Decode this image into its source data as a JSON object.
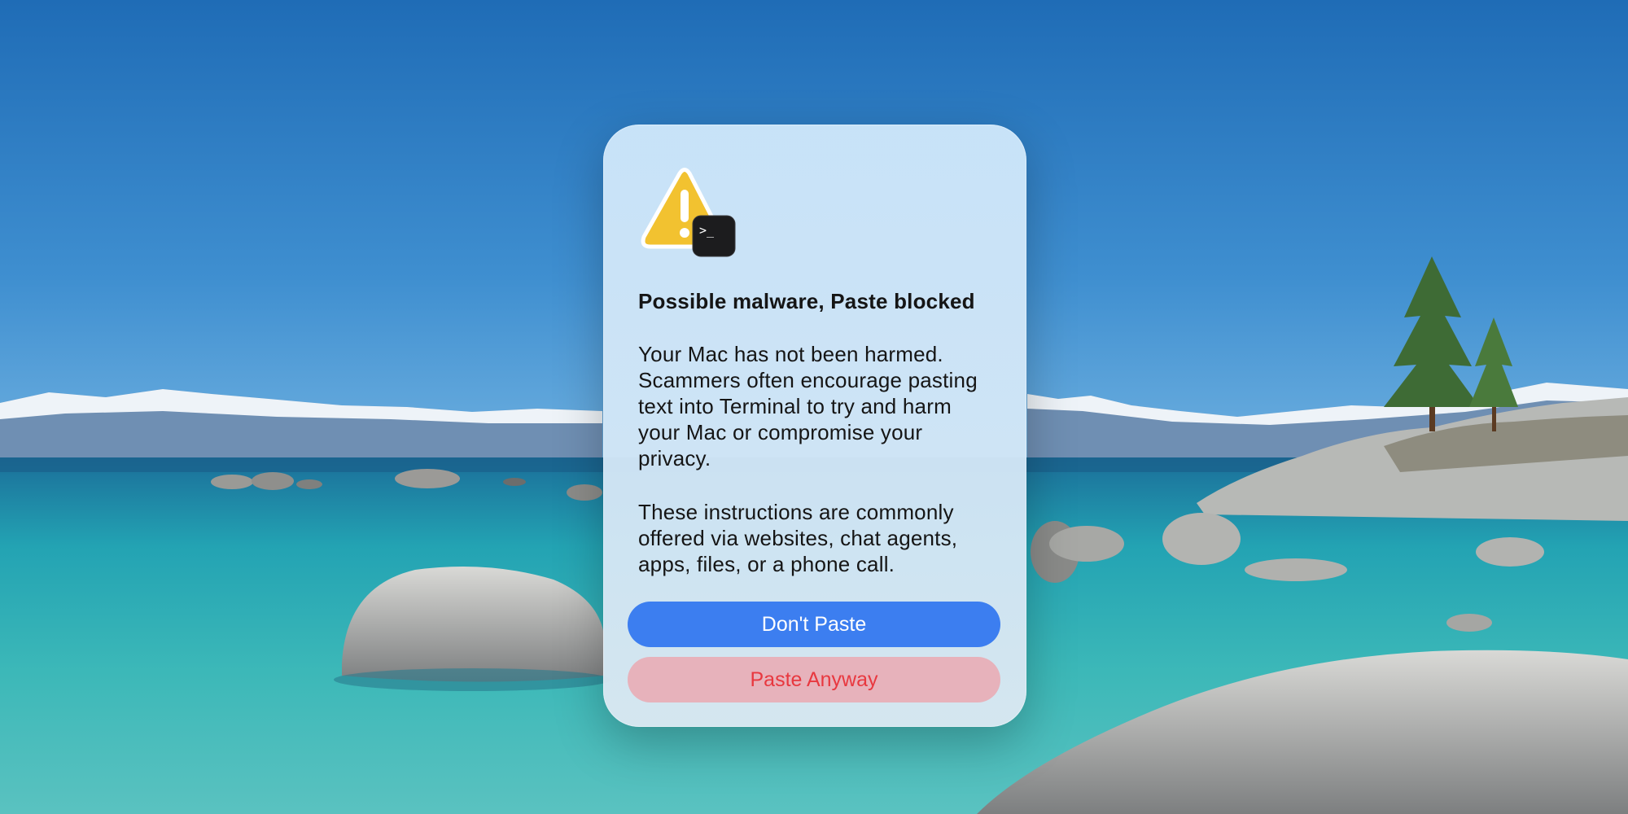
{
  "alert": {
    "icon": "warning-triangle-icon",
    "badge_icon": "terminal-icon",
    "badge_prompt": ">_",
    "title": "Possible malware, Paste blocked",
    "body_lines_1": [
      "Your Mac has not been harmed.",
      "Scammers often encourage pasting",
      "text into Terminal to try and harm",
      "your Mac or compromise your",
      "privacy."
    ],
    "body_lines_2": [
      "These instructions are commonly",
      "offered via websites, chat agents,",
      "apps, files, or a phone call."
    ],
    "buttons": {
      "primary_label": "Don't Paste",
      "secondary_label": "Paste Anyway"
    }
  },
  "colors": {
    "primary_button": "#3c7ef0",
    "danger_text": "#e8383f",
    "warning_yellow": "#f2c230"
  }
}
